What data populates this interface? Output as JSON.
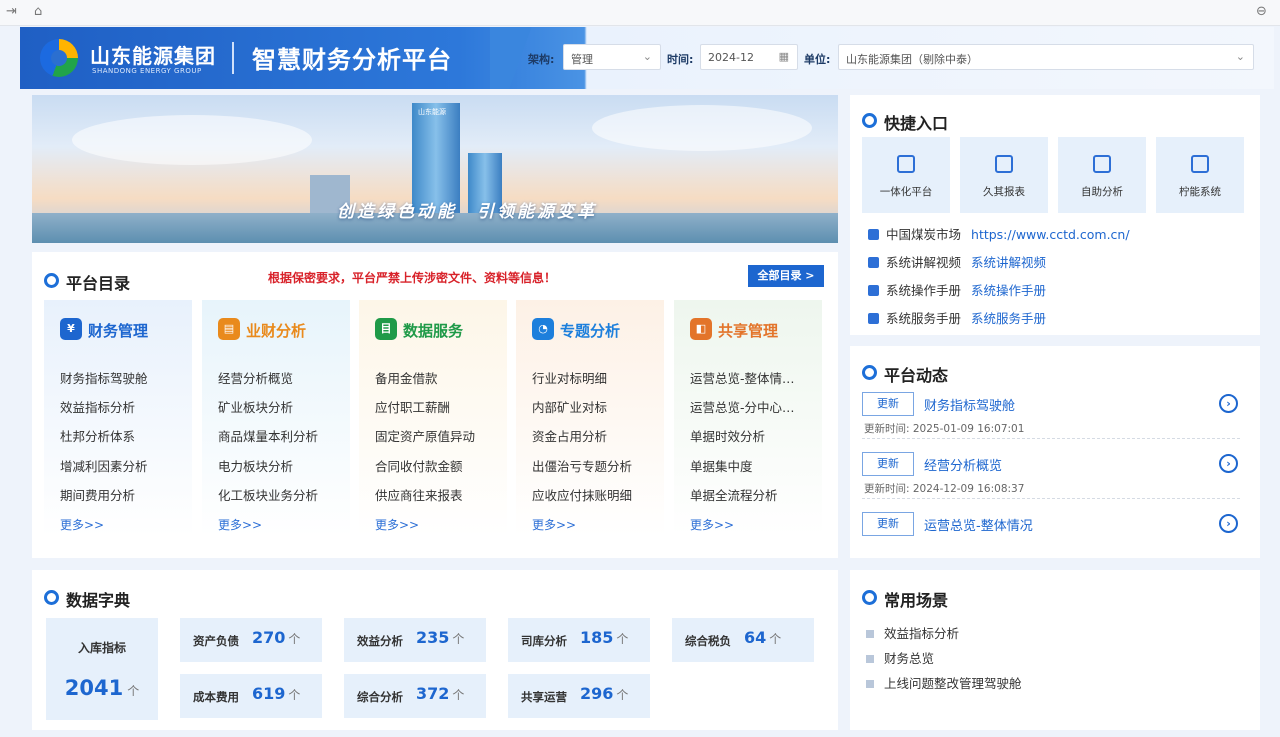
{
  "header": {
    "brand_cn": "山东能源集团",
    "brand_en": "SHANDONG ENERGY GROUP",
    "app_title": "智慧财务分析平台",
    "filters": {
      "arch_label": "架构:",
      "arch_value": "管理",
      "time_label": "时间:",
      "time_value": "2024-12",
      "unit_label": "单位:",
      "unit_value": "山东能源集团（剔除中泰）"
    }
  },
  "banner": {
    "slogan": "创造绿色动能　引领能源变革",
    "tower_sign": "山东能源"
  },
  "catalog": {
    "title": "平台目录",
    "notice": "根据保密要求，平台严禁上传涉密文件、资料等信息！",
    "all_button": "全部目录 >",
    "more": "更多>>",
    "categories": [
      {
        "title": "财务管理",
        "color": "#1d66cf",
        "bg": "#e8f1fc",
        "items": [
          "财务指标驾驶舱",
          "效益指标分析",
          "杜邦分析体系",
          "增减利因素分析",
          "期间费用分析"
        ]
      },
      {
        "title": "业财分析",
        "color": "#e98a1c",
        "bg": "#e7f4fb",
        "items": [
          "经营分析概览",
          "矿业板块分析",
          "商品煤量本利分析",
          "电力板块分析",
          "化工板块业务分析"
        ]
      },
      {
        "title": "数据服务",
        "color": "#1f9a48",
        "bg": "#fdf6e8",
        "items": [
          "备用金借款",
          "应付职工薪酬",
          "固定资产原值异动",
          "合同收付款金额",
          "供应商往来报表"
        ]
      },
      {
        "title": "专题分析",
        "color": "#1d7fdc",
        "bg": "#fdf1e6",
        "items": [
          "行业对标明细",
          "内部矿业对标",
          "资金占用分析",
          "出僵治亏专题分析",
          "应收应付抹账明细"
        ]
      },
      {
        "title": "共享管理",
        "color": "#e3742a",
        "bg": "#eef6ee",
        "items": [
          "运营总览-整体情…",
          "运营总览-分中心…",
          "单据时效分析",
          "单据集中度",
          "单据全流程分析"
        ]
      }
    ]
  },
  "quick": {
    "title": "快捷入口",
    "tiles": [
      "一体化平台",
      "久其报表",
      "自助分析",
      "柠能系统"
    ],
    "links": [
      {
        "name": "中国煤炭市场",
        "link": "https://www.cctd.com.cn/"
      },
      {
        "name": "系统讲解视频",
        "link": "系统讲解视频"
      },
      {
        "name": "系统操作手册",
        "link": "系统操作手册"
      },
      {
        "name": "系统服务手册",
        "link": "系统服务手册"
      }
    ]
  },
  "news": {
    "title": "平台动态",
    "items": [
      {
        "badge": "更新",
        "title": "财务指标驾驶舱",
        "time": "更新时间: 2025-01-09 16:07:01"
      },
      {
        "badge": "更新",
        "title": "经营分析概览",
        "time": "更新时间: 2024-12-09 16:08:37"
      },
      {
        "badge": "更新",
        "title": "运营总览-整体情况",
        "time": ""
      }
    ]
  },
  "dictionary": {
    "title": "数据字典",
    "main_label": "入库指标",
    "main_value": "2041",
    "unit": "个",
    "cells": [
      {
        "label": "资产负债",
        "value": "270"
      },
      {
        "label": "效益分析",
        "value": "235"
      },
      {
        "label": "司库分析",
        "value": "185"
      },
      {
        "label": "综合税负",
        "value": "64"
      },
      {
        "label": "成本费用",
        "value": "619"
      },
      {
        "label": "综合分析",
        "value": "372"
      },
      {
        "label": "共享运营",
        "value": "296"
      }
    ]
  },
  "scenes": {
    "title": "常用场景",
    "items": [
      "效益指标分析",
      "财务总览",
      "上线问题整改管理驾驶舱"
    ]
  }
}
